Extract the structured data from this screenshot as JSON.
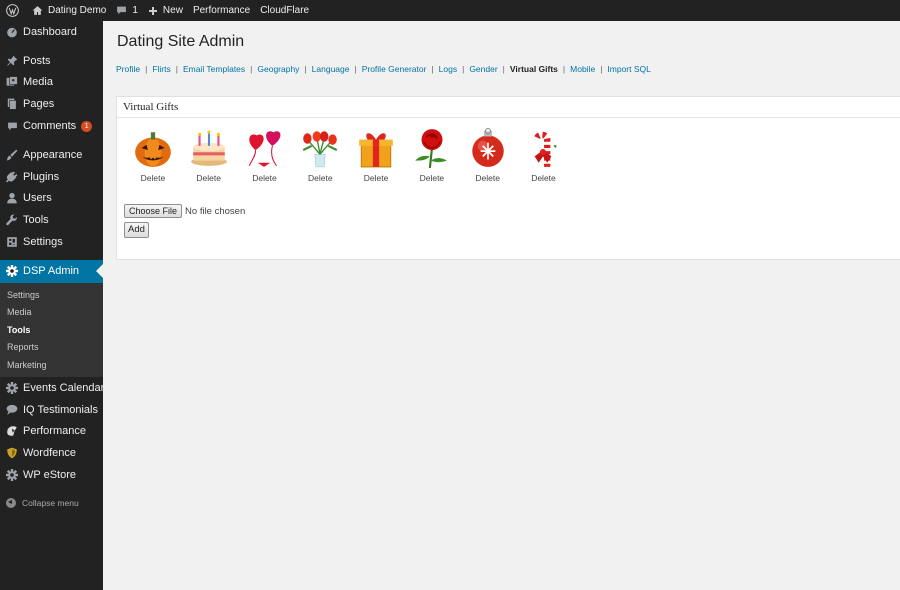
{
  "adminbar": {
    "items": [
      {
        "icon": "wordpress-icon",
        "label": ""
      },
      {
        "icon": "home-icon",
        "label": "Dating Demo"
      },
      {
        "icon": "comment-icon",
        "label": "1"
      },
      {
        "icon": "plus-icon",
        "label": "New"
      },
      {
        "icon": "",
        "label": "Performance"
      },
      {
        "icon": "",
        "label": "CloudFlare"
      }
    ]
  },
  "sidebar": {
    "group1": [
      {
        "icon": "dashboard-icon",
        "label": "Dashboard"
      }
    ],
    "group2": [
      {
        "icon": "pin-icon",
        "label": "Posts"
      },
      {
        "icon": "media-icon",
        "label": "Media"
      },
      {
        "icon": "pages-icon",
        "label": "Pages"
      },
      {
        "icon": "comment-icon",
        "label": "Comments",
        "badge": "1"
      }
    ],
    "group3": [
      {
        "icon": "paintbrush-icon",
        "label": "Appearance"
      },
      {
        "icon": "plugin-icon",
        "label": "Plugins"
      },
      {
        "icon": "user-icon",
        "label": "Users"
      },
      {
        "icon": "wrench-icon",
        "label": "Tools"
      },
      {
        "icon": "settings-icon",
        "label": "Settings"
      }
    ],
    "active": {
      "icon": "gear-icon",
      "label": "DSP Admin"
    },
    "submenu": [
      {
        "label": "Settings"
      },
      {
        "label": "Media"
      },
      {
        "label": "Tools",
        "current": true
      },
      {
        "label": "Reports"
      },
      {
        "label": "Marketing"
      }
    ],
    "group4": [
      {
        "icon": "gear-icon",
        "label": "Events Calendar"
      },
      {
        "icon": "speech-bubble-icon",
        "label": "IQ Testimonials"
      },
      {
        "icon": "performance-icon",
        "label": "Performance"
      },
      {
        "icon": "shield-icon",
        "label": "Wordfence"
      },
      {
        "icon": "gear-icon",
        "label": "WP eStore"
      }
    ],
    "collapse_label": "Collapse menu"
  },
  "main": {
    "title": "Dating Site Admin",
    "tabs": [
      {
        "label": "Profile"
      },
      {
        "label": "Flirts"
      },
      {
        "label": "Email Templates"
      },
      {
        "label": "Geography"
      },
      {
        "label": "Language"
      },
      {
        "label": "Profile Generator"
      },
      {
        "label": "Logs"
      },
      {
        "label": "Gender"
      },
      {
        "label": "Virtual Gifts",
        "current": true
      },
      {
        "label": "Mobile"
      },
      {
        "label": "Import SQL"
      }
    ],
    "panel": {
      "title": "Virtual Gifts",
      "gifts": [
        {
          "icon": "pumpkin-icon",
          "delete_label": "Delete"
        },
        {
          "icon": "cake-icon",
          "delete_label": "Delete"
        },
        {
          "icon": "heart-balloons-icon",
          "delete_label": "Delete"
        },
        {
          "icon": "tulip-vase-icon",
          "delete_label": "Delete"
        },
        {
          "icon": "gift-box-icon",
          "delete_label": "Delete"
        },
        {
          "icon": "rose-icon",
          "delete_label": "Delete"
        },
        {
          "icon": "ornament-icon",
          "delete_label": "Delete"
        },
        {
          "icon": "candy-cane-icon",
          "delete_label": "Delete"
        }
      ],
      "choose_file_label": "Choose File",
      "file_status": "No file chosen",
      "add_label": "Add"
    }
  },
  "colors": {
    "adminbar_bg": "#222222",
    "sidebar_bg": "#222222",
    "submenu_bg": "#333333",
    "active_bg": "#0074a2",
    "link": "#0074a2",
    "badge": "#d54e21",
    "page_bg": "#f1f1f1"
  }
}
